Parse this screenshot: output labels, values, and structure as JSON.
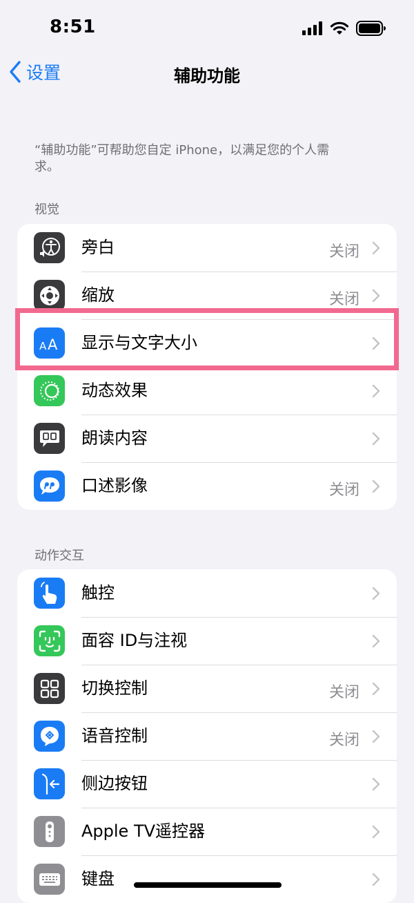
{
  "status_bar": {
    "time": "8:51"
  },
  "nav": {
    "back_label": "设置",
    "title": "辅助功能"
  },
  "intro_text": "“辅助功能”可帮助您自定 iPhone，以满足您的个人需求。",
  "sections": [
    {
      "header": "视觉",
      "items": [
        {
          "label": "旁白",
          "value": "关闭",
          "icon": "voiceover-icon",
          "color": "#3a3a3c"
        },
        {
          "label": "缩放",
          "value": "关闭",
          "icon": "zoom-icon",
          "color": "#3a3a3c"
        },
        {
          "label": "显示与文字大小",
          "value": "",
          "icon": "text-size-icon",
          "color": "#1a7cf5"
        },
        {
          "label": "动态效果",
          "value": "",
          "icon": "motion-icon",
          "color": "#34c759"
        },
        {
          "label": "朗读内容",
          "value": "",
          "icon": "spoken-content-icon",
          "color": "#3a3a3c"
        },
        {
          "label": "口述影像",
          "value": "关闭",
          "icon": "audio-description-icon",
          "color": "#1a7cf5"
        }
      ]
    },
    {
      "header": "动作交互",
      "items": [
        {
          "label": "触控",
          "value": "",
          "icon": "touch-icon",
          "color": "#1a7cf5"
        },
        {
          "label": "面容 ID与注视",
          "value": "",
          "icon": "face-id-icon",
          "color": "#34c759"
        },
        {
          "label": "切换控制",
          "value": "关闭",
          "icon": "switch-control-icon",
          "color": "#3a3a3c"
        },
        {
          "label": "语音控制",
          "value": "关闭",
          "icon": "voice-control-icon",
          "color": "#1a7cf5"
        },
        {
          "label": "侧边按钮",
          "value": "",
          "icon": "side-button-icon",
          "color": "#1a7cf5"
        },
        {
          "label": "Apple TV遥控器",
          "value": "",
          "icon": "apple-tv-remote-icon",
          "color": "#8e8e93"
        },
        {
          "label": "键盘",
          "value": "",
          "icon": "keyboard-icon",
          "color": "#8e8e93"
        }
      ]
    }
  ]
}
